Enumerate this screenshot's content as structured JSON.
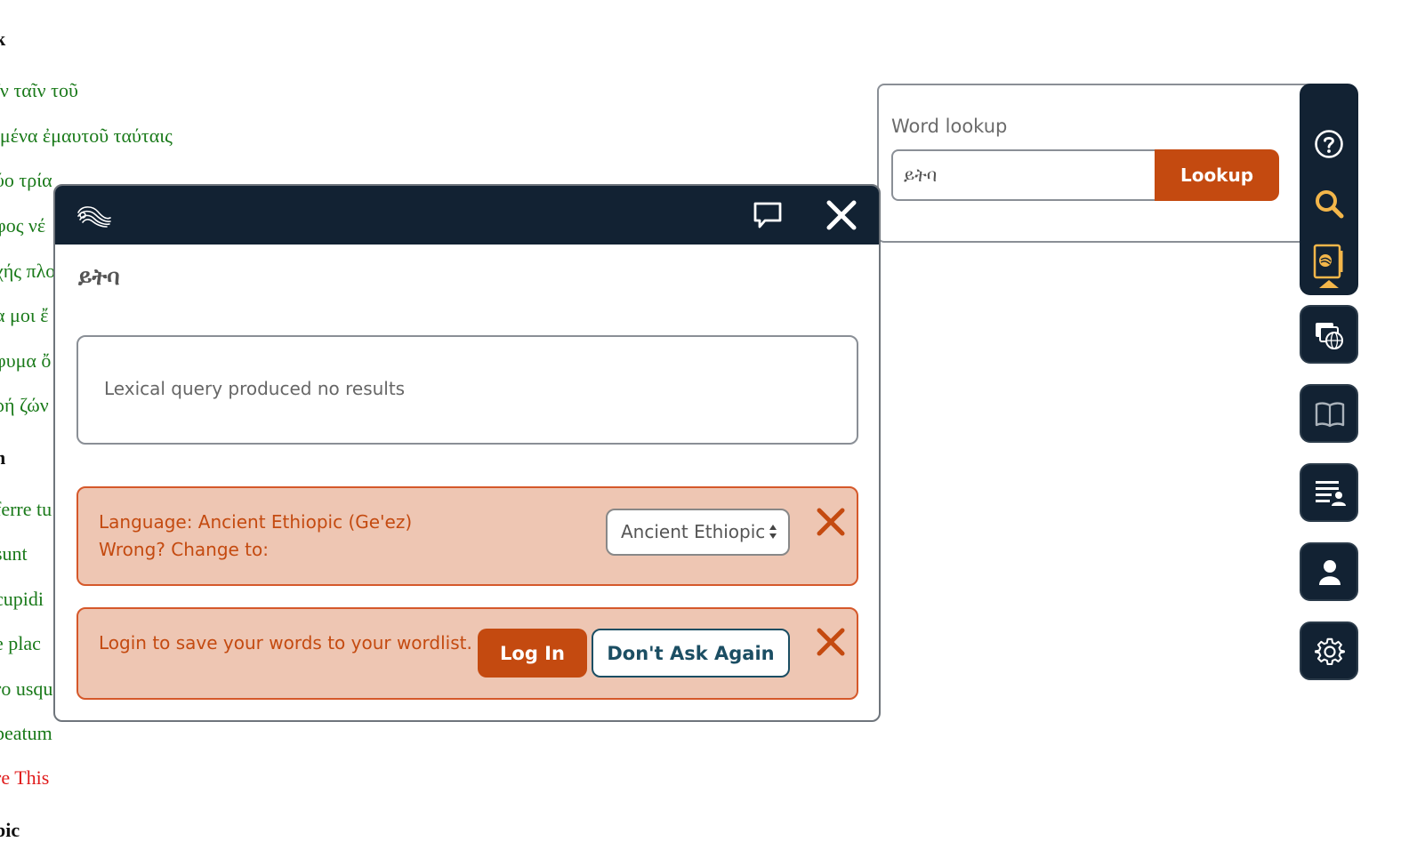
{
  "background_page": {
    "lines": [
      {
        "text": "k",
        "style": "head"
      },
      {
        "text": "ῖν ταῖν τοῦ",
        "style": "green"
      },
      {
        "text": "ιμένα ἐμαυτοῦ ταύταις",
        "style": "green"
      },
      {
        "text": "ύο τρία",
        "style": "green"
      },
      {
        "text": "φος νέ",
        "style": "green"
      },
      {
        "text": "χής πλο",
        "style": "green"
      },
      {
        "text": "α μοι ἔ",
        "style": "green"
      },
      {
        "text": "φυμα ὄ",
        "style": "green"
      },
      {
        "text": "ρή ζών",
        "style": "green"
      },
      {
        "text": "n",
        "style": "head"
      },
      {
        "text": "ferre tu",
        "style": "green"
      },
      {
        "text": "sunt",
        "style": "green"
      },
      {
        "text": "cupidi",
        "style": "green"
      },
      {
        "text": "e plac",
        "style": "green"
      },
      {
        "text": "ro usqu",
        "style": "green"
      },
      {
        "text": "beatum",
        "style": "green"
      },
      {
        "text": "re This",
        "style": "red"
      },
      {
        "text": "pic",
        "style": "head"
      }
    ]
  },
  "word_lookup": {
    "label": "Word lookup",
    "input_value": "ይትባ",
    "button_label": "Lookup"
  },
  "toolbar": {
    "items": [
      {
        "icon": "help-icon",
        "color": "#ffffff"
      },
      {
        "icon": "search-icon",
        "color": "#f3b64a"
      },
      {
        "icon": "word-popup-icon",
        "color": "#f3b64a",
        "active": true
      },
      {
        "icon": "translations-icon",
        "color": "#ffffff"
      },
      {
        "icon": "book-icon",
        "color": "#aab2ba"
      },
      {
        "icon": "wordlist-icon",
        "color": "#ffffff"
      },
      {
        "icon": "user-icon",
        "color": "#ffffff"
      },
      {
        "icon": "settings-icon",
        "color": "#ffffff"
      }
    ]
  },
  "popup": {
    "header_icons": [
      "logo-icon",
      "comment-icon",
      "close-icon"
    ],
    "word": "ይትባ",
    "result_message": "Lexical query produced no results",
    "language_alert": {
      "line1": "Language: Ancient Ethiopic (Ge'ez)",
      "line2": "Wrong? Change to:",
      "selected_language": "Ancient Ethiopic"
    },
    "login_alert": {
      "text": "Login to save your words to your wordlist.",
      "login_label": "Log In",
      "dont_ask_label": "Don't Ask Again"
    }
  },
  "colors": {
    "navy": "#122233",
    "accent_orange": "#c44a10",
    "alert_bg": "#eec6b3",
    "icon_gold": "#f3b64a",
    "greek_green": "#1a7a1a"
  }
}
